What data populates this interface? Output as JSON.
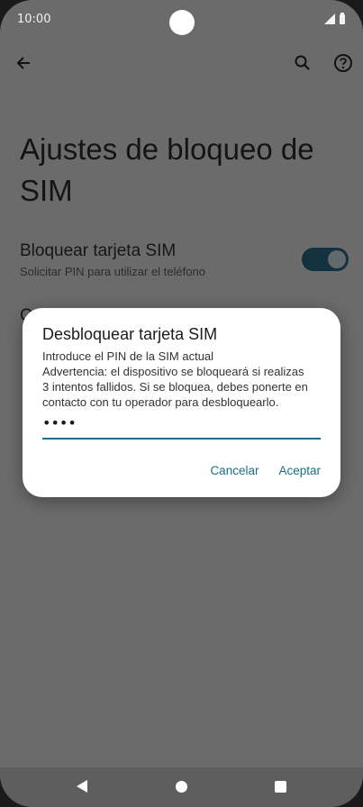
{
  "status_bar": {
    "time": "10:00"
  },
  "app_bar": {
    "icons": [
      "arrow-back-icon",
      "search-icon",
      "help-icon"
    ]
  },
  "page": {
    "title": "Ajustes de bloqueo de SIM"
  },
  "setting": {
    "title": "Bloquear tarjeta SIM",
    "subtitle": "Solicitar PIN para utilizar el teléfono",
    "toggle_on": true,
    "partial_label": "C"
  },
  "dialog": {
    "title": "Desbloquear tarjeta SIM",
    "body_lines": [
      "Introduce el PIN de la SIM actual",
      "Advertencia: el dispositivo se bloqueará si realizas",
      "3 intentos fallidos. Si se bloquea, debes ponerte en",
      "contacto con tu operador para desbloquearlo."
    ],
    "pin_masked": "••••",
    "cancel_label": "Cancelar",
    "accept_label": "Aceptar"
  },
  "nav_bar": {
    "icons": [
      "back-icon",
      "home-icon",
      "recents-icon"
    ]
  },
  "colors": {
    "accent": "#1b6f86",
    "toggle_track": "#133240",
    "scrim": "#6b6b6b"
  }
}
